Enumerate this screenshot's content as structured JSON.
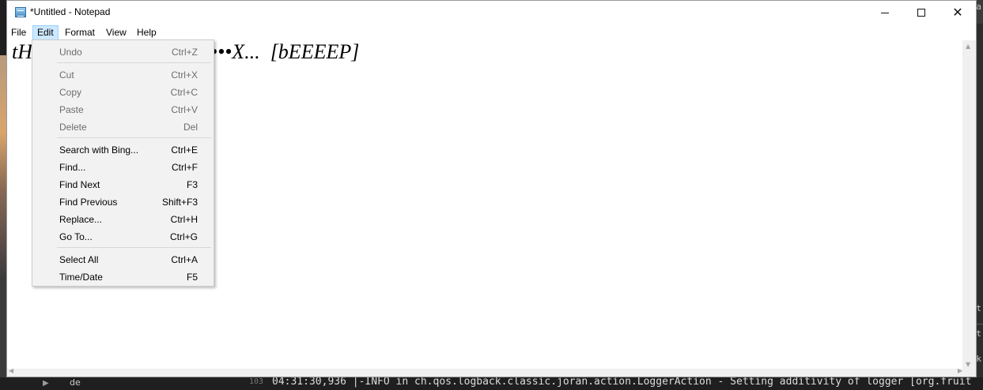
{
  "window": {
    "title": "*Untitled - Notepad",
    "controls": {
      "minimize": "—",
      "maximize": "☐",
      "close": "✕"
    }
  },
  "menubar": {
    "items": [
      {
        "label": "File"
      },
      {
        "label": "Edit",
        "active": true
      },
      {
        "label": "Format"
      },
      {
        "label": "View"
      },
      {
        "label": "Help"
      }
    ]
  },
  "editor": {
    "visible_text_fragment": "tH",
    "visible_text_after_menu": "•••X...  [bEEEEP]"
  },
  "edit_menu": {
    "groups": [
      [
        {
          "label": "Undo",
          "shortcut": "Ctrl+Z",
          "enabled": false
        }
      ],
      [
        {
          "label": "Cut",
          "shortcut": "Ctrl+X",
          "enabled": false
        },
        {
          "label": "Copy",
          "shortcut": "Ctrl+C",
          "enabled": false
        },
        {
          "label": "Paste",
          "shortcut": "Ctrl+V",
          "enabled": false
        },
        {
          "label": "Delete",
          "shortcut": "Del",
          "enabled": false
        }
      ],
      [
        {
          "label": "Search with Bing...",
          "shortcut": "Ctrl+E",
          "enabled": true
        },
        {
          "label": "Find...",
          "shortcut": "Ctrl+F",
          "enabled": true
        },
        {
          "label": "Find Next",
          "shortcut": "F3",
          "enabled": true
        },
        {
          "label": "Find Previous",
          "shortcut": "Shift+F3",
          "enabled": true
        },
        {
          "label": "Replace...",
          "shortcut": "Ctrl+H",
          "enabled": true
        },
        {
          "label": "Go To...",
          "shortcut": "Ctrl+G",
          "enabled": true
        }
      ],
      [
        {
          "label": "Select All",
          "shortcut": "Ctrl+A",
          "enabled": true
        },
        {
          "label": "Time/Date",
          "shortcut": "F5",
          "enabled": true
        }
      ]
    ]
  },
  "background": {
    "right_texts": [
      "ja",
      "ut",
      "ut",
      "nk"
    ],
    "taskbar_lang": "de",
    "log_line_number": "103",
    "log_line": "04:31:30,936 |-INFO in ch.qos.logback.classic.joran.action.LoggerAction - Setting additivity of logger [org.fruit"
  },
  "colors": {
    "menu_active_bg": "#cce8ff",
    "dropdown_bg": "#f2f2f2",
    "disabled_text": "#6d6d6d"
  }
}
